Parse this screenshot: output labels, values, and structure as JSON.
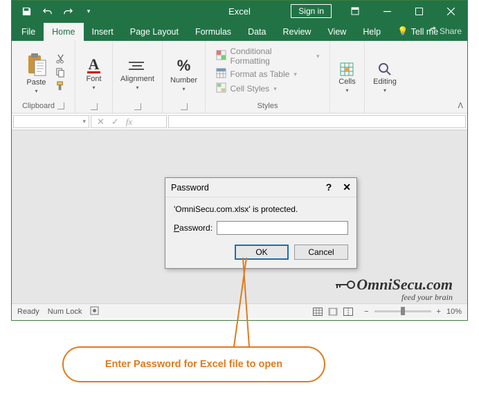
{
  "title": "Excel",
  "signin": "Sign in",
  "tabs": {
    "file": "File",
    "home": "Home",
    "insert": "Insert",
    "pageLayout": "Page Layout",
    "formulas": "Formulas",
    "data": "Data",
    "review": "Review",
    "view": "View",
    "help": "Help",
    "tellme": "Tell me",
    "share": "Share"
  },
  "ribbon": {
    "clipboard": {
      "paste": "Paste",
      "label": "Clipboard"
    },
    "font": {
      "label": "Font"
    },
    "alignment": {
      "label": "Alignment"
    },
    "number": {
      "label": "Number"
    },
    "styles": {
      "condFormat": "Conditional Formatting",
      "formatTable": "Format as Table",
      "cellStyles": "Cell Styles",
      "label": "Styles"
    },
    "cells": {
      "label": "Cells"
    },
    "editing": {
      "label": "Editing"
    }
  },
  "dialog": {
    "title": "Password",
    "message": "'OmniSecu.com.xlsx' is protected.",
    "fieldLabel": "assword:",
    "fieldPrefix": "P",
    "ok": "OK",
    "cancel": "Cancel"
  },
  "statusbar": {
    "ready": "Ready",
    "numlock": "Num Lock",
    "zoom": "10%"
  },
  "callout": "Enter Password for Excel file to open",
  "logo": {
    "main": "mniSecu.com",
    "o": "O",
    "sub": "feed your brain"
  }
}
